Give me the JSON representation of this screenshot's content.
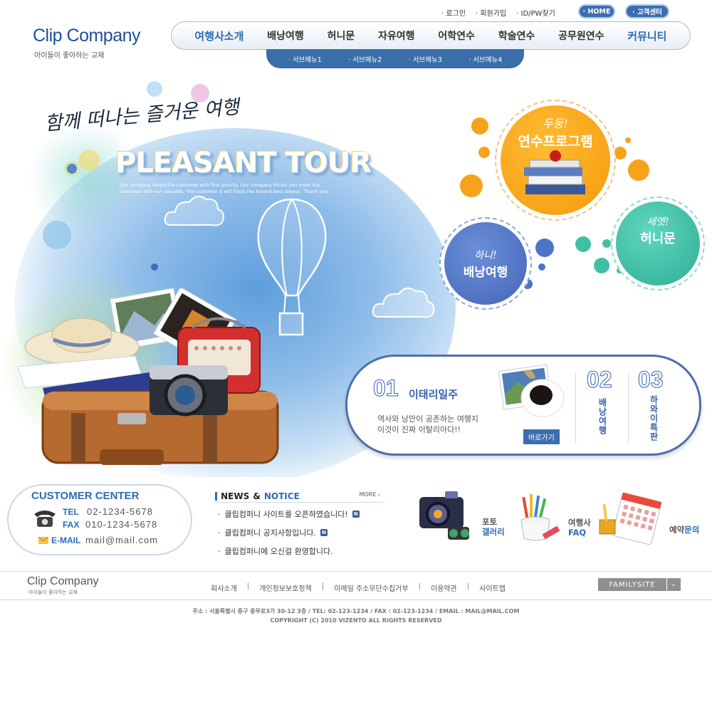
{
  "util": {
    "login": "로그인",
    "join": "회원가입",
    "find": "ID/PW찾기",
    "home": "· HOME",
    "customer": "· 고객센터"
  },
  "logo": {
    "part1": "Clip Co",
    "part2": "mpany",
    "sub": "아이들이 좋아하는 교재"
  },
  "nav": [
    "여행사소개",
    "배낭여행",
    "허니문",
    "자유여행",
    "어학연수",
    "학술연수",
    "공무원연수",
    "커뮤니티"
  ],
  "subnav": [
    "서브메뉴1",
    "서브메뉴2",
    "서브메뉴3",
    "서브메뉴4"
  ],
  "hero": {
    "script": "함께 떠나는 즐거운 여행",
    "title": "PLEASANT TOUR",
    "tagline": "Our company treats the customer with first priority. Our company thinks you meet the customer with our valuable. The customer it will finish the hazard best always. Thank you."
  },
  "circles": {
    "training": {
      "tag": "두둥!",
      "title": "연수프로그램"
    },
    "backpack": {
      "tag": "하니!",
      "title": "배낭여행"
    },
    "honeymoon": {
      "tag": "세엣!",
      "title": "허니문"
    }
  },
  "feature": {
    "num1": "01",
    "title1": "이태리일주",
    "desc1": "역사와 낭만이 공존하는 여행지",
    "desc2": "이것이 진짜 이탈리아다!!",
    "go": "바로가기",
    "num2": "02",
    "label2": "배낭여행",
    "num3": "03",
    "label3": "하와이특판"
  },
  "customer": {
    "title": "CUSTOMER CENTER",
    "tel_label": "TEL",
    "tel": "02-1234-5678",
    "fax_label": "FAX",
    "fax": "010-1234-5678",
    "email_label": "E-MAIL",
    "email": "mail@mail.com"
  },
  "news": {
    "title1": "NEWS",
    "amp": "&",
    "title2": "NOTICE",
    "more": "MORE",
    "items": [
      "클립컴퍼니 사이트를 오픈하였습니다!",
      "클립컴퍼니 공지사항입니다.",
      "클립컴퍼니에 오신걸 환영합니다."
    ]
  },
  "quick": {
    "gallery_top": "포토",
    "gallery_bottom": "갤러리",
    "faq_top": "여행사",
    "faq_bottom": "FAQ",
    "reserve_top": "예약",
    "reserve_bottom": "문의"
  },
  "footer": {
    "logo1": "Clip Co",
    "logo2": "mpany",
    "logo_sub": "아이들이 좋아하는 교재",
    "links": [
      "회사소개",
      "개인정보보호정책",
      "이메일 주소무단수집거부",
      "이용약관",
      "사이트맵"
    ],
    "familysite": "FAMILYSITE",
    "address": "주소 : 서울특별시 중구 충무로3가 30-12 3층 / TEL: 02-123-1234 / FAX : 02-123-1234 / EMAIL : MAIL@MAIL.COM",
    "copyright": "COPYRIGHT (C) 2010 VIZENTO  ALL RIGHTS RESERVED"
  },
  "colors": {
    "brand": "#2e6bb5",
    "orange": "#f5a214",
    "blue_circle": "#4f74c6",
    "teal": "#3fbfa6"
  }
}
